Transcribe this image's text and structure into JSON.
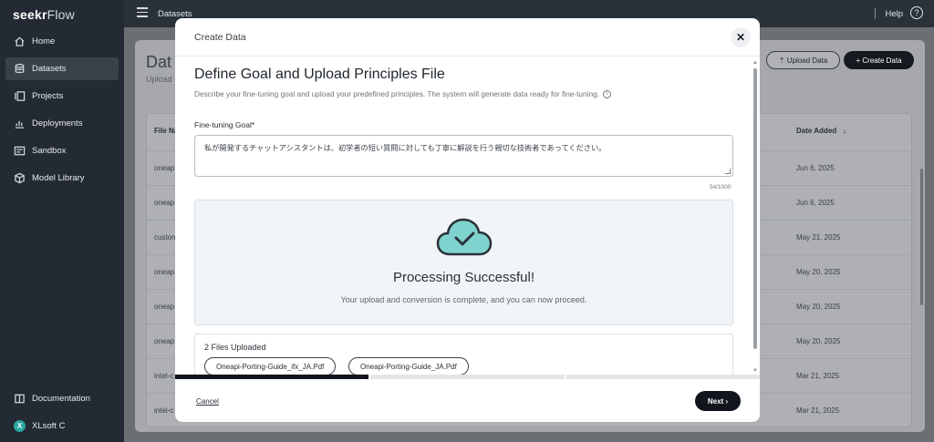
{
  "brand": {
    "name_bold": "seekr",
    "name_light": "Flow"
  },
  "sidebar": {
    "items": [
      {
        "label": "Home",
        "icon": "home-icon"
      },
      {
        "label": "Datasets",
        "icon": "database-icon",
        "active": true
      },
      {
        "label": "Projects",
        "icon": "projects-icon"
      },
      {
        "label": "Deployments",
        "icon": "chart-icon"
      },
      {
        "label": "Sandbox",
        "icon": "sandbox-icon"
      },
      {
        "label": "Model Library",
        "icon": "cube-icon"
      }
    ],
    "bottom": [
      {
        "label": "Documentation",
        "icon": "book-icon"
      },
      {
        "label": "XLsoft C",
        "avatar": "X"
      }
    ]
  },
  "topbar": {
    "breadcrumb": "Datasets",
    "help": "Help",
    "help_glyph": "?"
  },
  "background": {
    "title": "Dat",
    "subtitle": "Upload",
    "upload_button": "Upload Data",
    "create_button": "+ Create Data",
    "col_file": "File Na",
    "col_date": "Date Added",
    "rows": [
      {
        "file": "oneap",
        "date": "Jun 6, 2025"
      },
      {
        "file": "oneap",
        "date": "Jun 6, 2025"
      },
      {
        "file": "custom",
        "date": "May 21, 2025"
      },
      {
        "file": "oneap",
        "date": "May 20, 2025"
      },
      {
        "file": "oneap",
        "date": "May 20, 2025"
      },
      {
        "file": "oneap",
        "date": "May 20, 2025"
      },
      {
        "file": "intel-c",
        "date": "Mar 21, 2025"
      },
      {
        "file": "intel-c",
        "date": "Mar 21, 2025"
      }
    ]
  },
  "modal": {
    "title": "Create Data",
    "close_glyph": "✕",
    "heading": "Define Goal and Upload Principles File",
    "description": "Describe your fine-tuning goal and upload your predefined principles. The system will generate data ready for fine-tuning.",
    "goal_label": "Fine-tuning Goal*",
    "goal_value": "私が開発するチャットアシスタントは、初学者の短い質問に対しても丁寧に解説を行う親切な技術者であってください。",
    "char_count": "54/1000",
    "success_title": "Processing Successful!",
    "success_subtitle": "Your upload and conversion is complete, and you can now proceed.",
    "files_title": "2 Files Uploaded",
    "files": [
      "Oneapi-Porting-Guide_ifx_JA.Pdf",
      "Oneapi-Porting-Guide_JA.Pdf"
    ],
    "progress_steps_done": 1,
    "progress_steps_total": 3,
    "cancel": "Cancel",
    "next": "Next ›"
  },
  "colors": {
    "accent": "#11161c",
    "cloud_fill": "#7fd3cf",
    "cloud_stroke": "#2b3138"
  }
}
